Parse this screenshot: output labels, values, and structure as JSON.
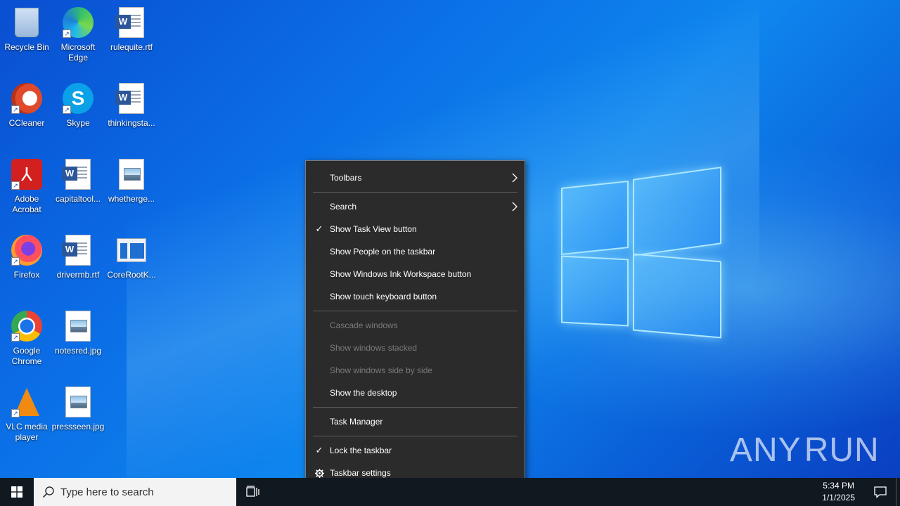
{
  "desktop": {
    "icons": [
      {
        "label": "Recycle Bin",
        "icon": "recycle-bin-icon"
      },
      {
        "label": "Microsoft Edge",
        "icon": "edge-icon"
      },
      {
        "label": "rulequite.rtf",
        "icon": "word-document-icon"
      },
      {
        "label": "CCleaner",
        "icon": "ccleaner-icon"
      },
      {
        "label": "Skype",
        "icon": "skype-icon"
      },
      {
        "label": "thinkingsta...",
        "icon": "word-document-icon"
      },
      {
        "label": "Adobe Acrobat",
        "icon": "acrobat-icon"
      },
      {
        "label": "capitaltool...",
        "icon": "word-document-icon"
      },
      {
        "label": "whetherge...",
        "icon": "image-file-icon"
      },
      {
        "label": "Firefox",
        "icon": "firefox-icon"
      },
      {
        "label": "drivermb.rtf",
        "icon": "word-document-icon"
      },
      {
        "label": "CoreRootK...",
        "icon": "app-window-icon"
      },
      {
        "label": "Google Chrome",
        "icon": "chrome-icon"
      },
      {
        "label": "notesred.jpg",
        "icon": "image-file-icon"
      },
      {
        "label": "VLC media player",
        "icon": "vlc-icon"
      },
      {
        "label": "pressseen.jpg",
        "icon": "image-file-icon"
      }
    ]
  },
  "context_menu": {
    "items": [
      {
        "label": "Toolbars",
        "submenu": true,
        "checked": false,
        "disabled": false
      },
      {
        "label": "Search",
        "submenu": true,
        "checked": false,
        "disabled": false
      },
      {
        "label": "Show Task View button",
        "submenu": false,
        "checked": true,
        "disabled": false
      },
      {
        "label": "Show People on the taskbar",
        "submenu": false,
        "checked": false,
        "disabled": false
      },
      {
        "label": "Show Windows Ink Workspace button",
        "submenu": false,
        "checked": false,
        "disabled": false
      },
      {
        "label": "Show touch keyboard button",
        "submenu": false,
        "checked": false,
        "disabled": false
      },
      {
        "label": "Cascade windows",
        "submenu": false,
        "checked": false,
        "disabled": true
      },
      {
        "label": "Show windows stacked",
        "submenu": false,
        "checked": false,
        "disabled": true
      },
      {
        "label": "Show windows side by side",
        "submenu": false,
        "checked": false,
        "disabled": true
      },
      {
        "label": "Show the desktop",
        "submenu": false,
        "checked": false,
        "disabled": false
      },
      {
        "label": "Task Manager",
        "submenu": false,
        "checked": false,
        "disabled": false
      },
      {
        "label": "Lock the taskbar",
        "submenu": false,
        "checked": true,
        "disabled": false
      },
      {
        "label": "Taskbar settings",
        "submenu": false,
        "checked": false,
        "disabled": false,
        "icon": "gear-icon"
      }
    ],
    "check_glyph": "✓"
  },
  "watermark": {
    "left": "ANY",
    "right": "RUN"
  },
  "taskbar": {
    "search_placeholder": "Type here to search",
    "time": "5:34 PM",
    "date": "1/1/2025"
  },
  "colors": {
    "menu_bg": "#2b2b2b",
    "menu_text": "#ffffff",
    "menu_disabled": "#7a7a7a",
    "taskbar_bg": "#101820",
    "desktop_accent": "#0b6ee6"
  }
}
